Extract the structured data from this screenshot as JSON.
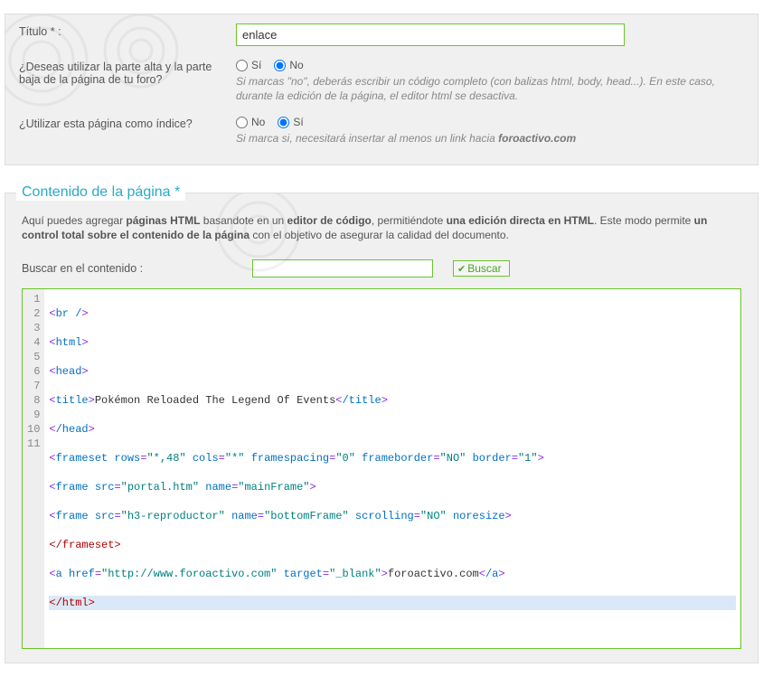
{
  "form": {
    "title_label": "Título * :",
    "title_value": "enlace",
    "q_header_label": "¿Deseas utilizar la parte alta y la parte baja de la página de tu foro?",
    "q_header_opt_yes": "Sí",
    "q_header_opt_no": "No",
    "q_header_hint": "Si marcas \"no\", deberás escribir un código completo (con balizas html, body, head...). En este caso, durante la edición de la página, el editor html se desactiva.",
    "q_index_label": "¿Utilizar esta página como índice?",
    "q_index_opt_no": "No",
    "q_index_opt_yes": "Sí",
    "q_index_hint_pre": "Si marca si, necesitará insertar al menos un link hacia ",
    "q_index_hint_bold": "foroactivo.com"
  },
  "section2": {
    "legend": "Contenido de la página *",
    "intro_1": "Aquí puedes agregar ",
    "intro_b1": "páginas HTML",
    "intro_2": " basandote en un ",
    "intro_b2": "editor de código",
    "intro_3": ", permitiéndote ",
    "intro_b3": "una edición directa en HTML",
    "intro_4": ". Este modo permite ",
    "intro_b4": "un control total sobre el contenido de la página",
    "intro_5": " con el objetivo de asegurar la calidad del documento.",
    "search_label": "Buscar en el contenido :",
    "search_value": "",
    "search_btn": "Buscar"
  },
  "code": {
    "lines": [
      "1",
      "2",
      "3",
      "4",
      "5",
      "6",
      "7",
      "8",
      "9",
      "10",
      "11"
    ],
    "l1_tag": "br /",
    "l2_tag": "html",
    "l3_tag": "head",
    "l4_open": "title",
    "l4_text": "Pokémon Reloaded The Legend Of Events",
    "l4_close": "/title",
    "l5_tag": "/head",
    "l6_open": "frameset",
    "l6_a1n": "rows",
    "l6_a1v": "\"*,48\"",
    "l6_a2n": "cols",
    "l6_a2v": "\"*\"",
    "l6_a3n": "framespacing",
    "l6_a3v": "\"0\"",
    "l6_a4n": "frameborder",
    "l6_a4v": "\"NO\"",
    "l6_a5n": "border",
    "l6_a5v": "\"1\"",
    "l7_open": "frame",
    "l7_a1n": "src",
    "l7_a1v": "\"portal.htm\"",
    "l7_a2n": "name",
    "l7_a2v": "\"mainFrame\"",
    "l8_open": "frame",
    "l8_a1n": "src",
    "l8_a1v": "\"h3-reproductor\"",
    "l8_a2n": "name",
    "l8_a2v": "\"bottomFrame\"",
    "l8_a3n": "scrolling",
    "l8_a3v": "\"NO\"",
    "l8_a4": "noresize",
    "l9_tag": "/frameset",
    "l10_open": "a",
    "l10_a1n": "href",
    "l10_a1v": "\"http://www.foroactivo.com\"",
    "l10_a2n": "target",
    "l10_a2v": "\"_blank\"",
    "l10_text": "foroactivo.com",
    "l10_close": "/a",
    "l11_tag": "/html"
  }
}
